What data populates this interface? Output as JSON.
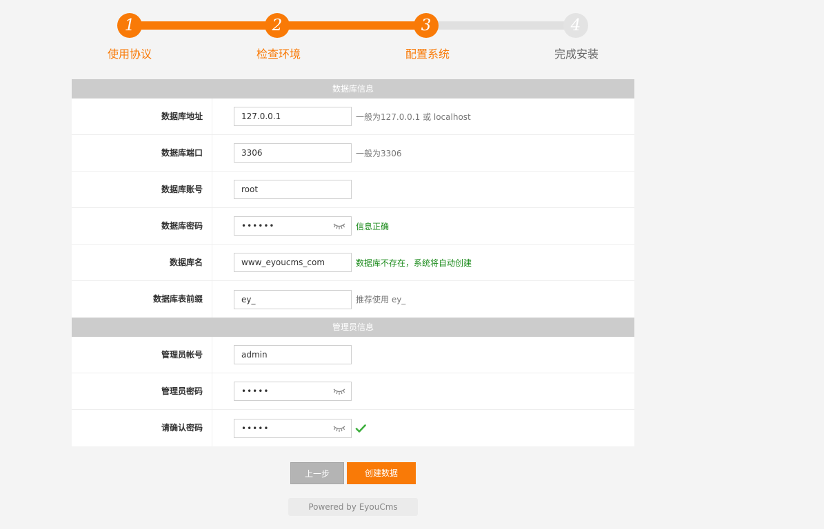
{
  "steps": [
    {
      "num": "1",
      "label": "使用协议",
      "state": "done"
    },
    {
      "num": "2",
      "label": "检查环境",
      "state": "done"
    },
    {
      "num": "3",
      "label": "配置系统",
      "state": "current"
    },
    {
      "num": "4",
      "label": "完成安装",
      "state": "todo"
    }
  ],
  "colors": {
    "accent": "#f97a07",
    "ok": "#1a8a1a",
    "section": "#cccccc"
  },
  "db_section": {
    "title": "数据库信息",
    "host": {
      "label": "数据库地址",
      "value": "127.0.0.1",
      "hint": "一般为127.0.0.1 或 localhost"
    },
    "port": {
      "label": "数据库端口",
      "value": "3306",
      "hint": "一般为3306"
    },
    "user": {
      "label": "数据库账号",
      "value": "root"
    },
    "password": {
      "label": "数据库密码",
      "value": "••••••",
      "hint": "信息正确"
    },
    "name": {
      "label": "数据库名",
      "value": "www_eyoucms_com",
      "hint": "数据库不存在，系统将自动创建"
    },
    "prefix": {
      "label": "数据库表前缀",
      "value": "ey_",
      "hint": "推荐使用 ey_"
    }
  },
  "admin_section": {
    "title": "管理员信息",
    "account": {
      "label": "管理员帐号",
      "value": "admin"
    },
    "password": {
      "label": "管理员密码",
      "value": "•••••"
    },
    "confirm": {
      "label": "请确认密码",
      "value": "•••••"
    }
  },
  "buttons": {
    "prev": "上一步",
    "create": "创建数据"
  },
  "footer": {
    "powered": "Powered by EyouCms"
  },
  "icons": {
    "eye": "eye-closed-icon",
    "check": "check-icon"
  }
}
